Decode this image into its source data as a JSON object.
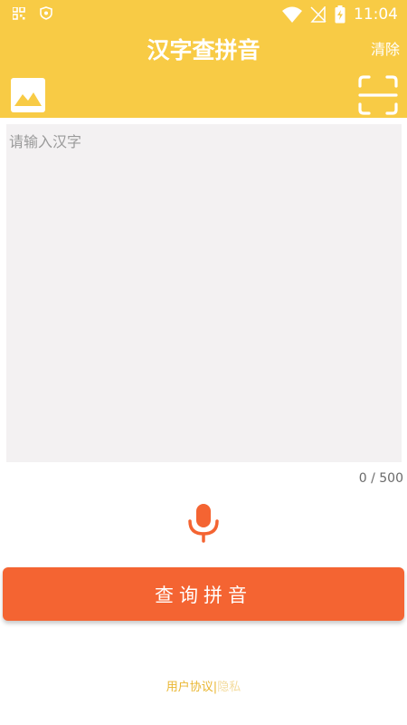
{
  "status_bar": {
    "time": "11:04",
    "icons": [
      "qr-grid-icon",
      "shield-icon",
      "wifi-icon",
      "no-sim-icon",
      "battery-charging-icon"
    ]
  },
  "header": {
    "title": "汉字查拼音",
    "clear_label": "清除",
    "image_icon": "image-icon",
    "scan_icon": "scan-icon"
  },
  "input": {
    "value": "",
    "placeholder": "请输入汉字"
  },
  "counter": "0 / 500",
  "mic_icon": "microphone-icon",
  "query_button_label": "查询拼音",
  "footer": {
    "agreement": "用户协议",
    "separator": "|",
    "privacy": "隐私"
  },
  "colors": {
    "header_bg": "#f8cb45",
    "input_bg": "#f3f1f2",
    "accent": "#f46432",
    "footer_link": "#e9b630"
  }
}
